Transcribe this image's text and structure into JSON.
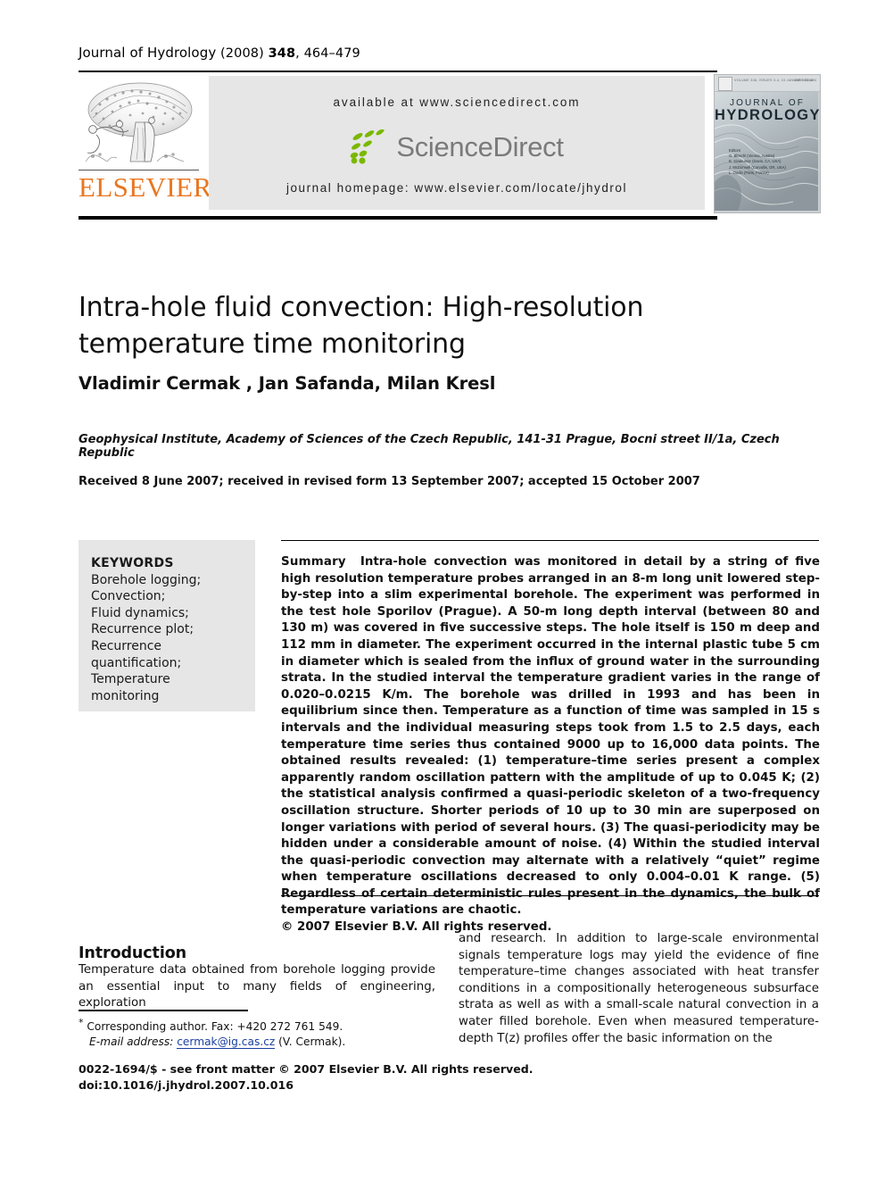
{
  "running_head": {
    "journal": "Journal of Hydrology",
    "year": "(2008)",
    "volume": "348",
    "pages": ", 464–479"
  },
  "masthead": {
    "publisher_name": "ELSEVIER",
    "available_at": "available at www.sciencedirect.com",
    "sciencedirect_wordmark": "ScienceDirect",
    "journal_homepage": "journal homepage: www.elsevier.com/locate/jhydrol",
    "cover": {
      "top_line": "VOLUME 348, ISSUES 3-4, 15 JANUARY 2008",
      "issn": "ISSN 0022-1694",
      "title_line1": "JOURNAL OF",
      "title_line2": "HYDROLOGY",
      "editors_label": "Editors",
      "editors": [
        "G. Blöschl (Vienna, Austria)",
        "B. Sivakumar (Davis, CA, USA)",
        "J. McDonnell (Corvallis, OR, USA)",
        "L. Oudin (Paris, France)"
      ]
    },
    "colors": {
      "elsevier_orange": "#E87722",
      "band_grey": "#e6e6e6",
      "sciencedirect_green": "#7AB800",
      "sciencedirect_grey": "#7a7a7a"
    }
  },
  "article": {
    "title": "Intra-hole fluid convection: High-resolution temperature time monitoring",
    "authors": "Vladimir Cermak , Jan Safanda, Milan Kresl",
    "author_footnote_marker": "*",
    "affiliation": "Geophysical Institute, Academy of Sciences of the Czech Republic, 141-31 Prague, Bocni street II/1a, Czech Republic",
    "received": "Received 8 June 2007; received in revised form 13 September 2007; accepted 15 October 2007"
  },
  "keywords": {
    "heading": "KEYWORDS",
    "items": [
      "Borehole logging;",
      "Convection;",
      "Fluid dynamics;",
      "Recurrence plot;",
      "Recurrence",
      "quantification;",
      "Temperature",
      "monitoring"
    ]
  },
  "summary": {
    "label": "Summary",
    "text": "Intra-hole convection was monitored in detail by a string of five high resolution temperature probes arranged in an 8-m long unit lowered step-by-step into a slim experimental borehole. The experiment was performed in the test hole Sporilov (Prague). A 50-m long depth interval (between 80 and 130 m) was covered in five successive steps. The hole itself is 150 m deep and 112 mm in diameter. The experiment occurred in the internal plastic tube 5 cm in diameter which is sealed from the influx of ground water in the surrounding strata. In the studied interval the temperature gradient varies in the range of 0.020–0.0215 K/m. The borehole was drilled in 1993 and has been in equilibrium since then. Temperature as a function of time was sampled in 15 s intervals and the individual measuring steps took from 1.5 to 2.5 days, each temperature time series thus contained 9000 up to 16,000 data points. The obtained results revealed: (1) temperature–time series present a complex apparently random oscillation pattern with the amplitude of up to 0.045 K; (2) the statistical analysis confirmed a quasi-periodic skeleton of a two-frequency oscillation structure. Shorter periods of 10 up to 30 min are superposed on longer variations with period of several hours. (3) The quasi-periodicity may be hidden under a considerable amount of noise. (4) Within the studied interval the quasi-periodic convection may alternate with a relatively “quiet” regime when temperature oscillations decreased to only 0.004–0.01 K range. (5) Regardless of certain deterministic rules present in the dynamics, the bulk of temperature variations are chaotic.",
    "copyright": "© 2007 Elsevier B.V. All rights reserved."
  },
  "body": {
    "section_heading": "Introduction",
    "left_column": "Temperature data obtained from borehole logging provide an essential input to many fields of engineering, exploration",
    "right_column": "and research. In addition to large-scale environmental signals temperature logs may yield the evidence of fine temperature–time changes associated with heat transfer conditions in a compositionally heterogeneous subsurface strata as well as with a small-scale natural convection in a water filled borehole. Even when measured temperature-depth T(z) profiles offer the basic information on the"
  },
  "footnote": {
    "marker": "*",
    "line1": "Corresponding author. Fax: +420 272 761 549.",
    "email_label": "E-mail address:",
    "email": "cermak@ig.cas.cz",
    "email_suffix": "(V. Cermak)."
  },
  "footer": {
    "line1": "0022-1694/$ - see front matter © 2007 Elsevier B.V. All rights reserved.",
    "line2": "doi:10.1016/j.jhydrol.2007.10.016"
  }
}
